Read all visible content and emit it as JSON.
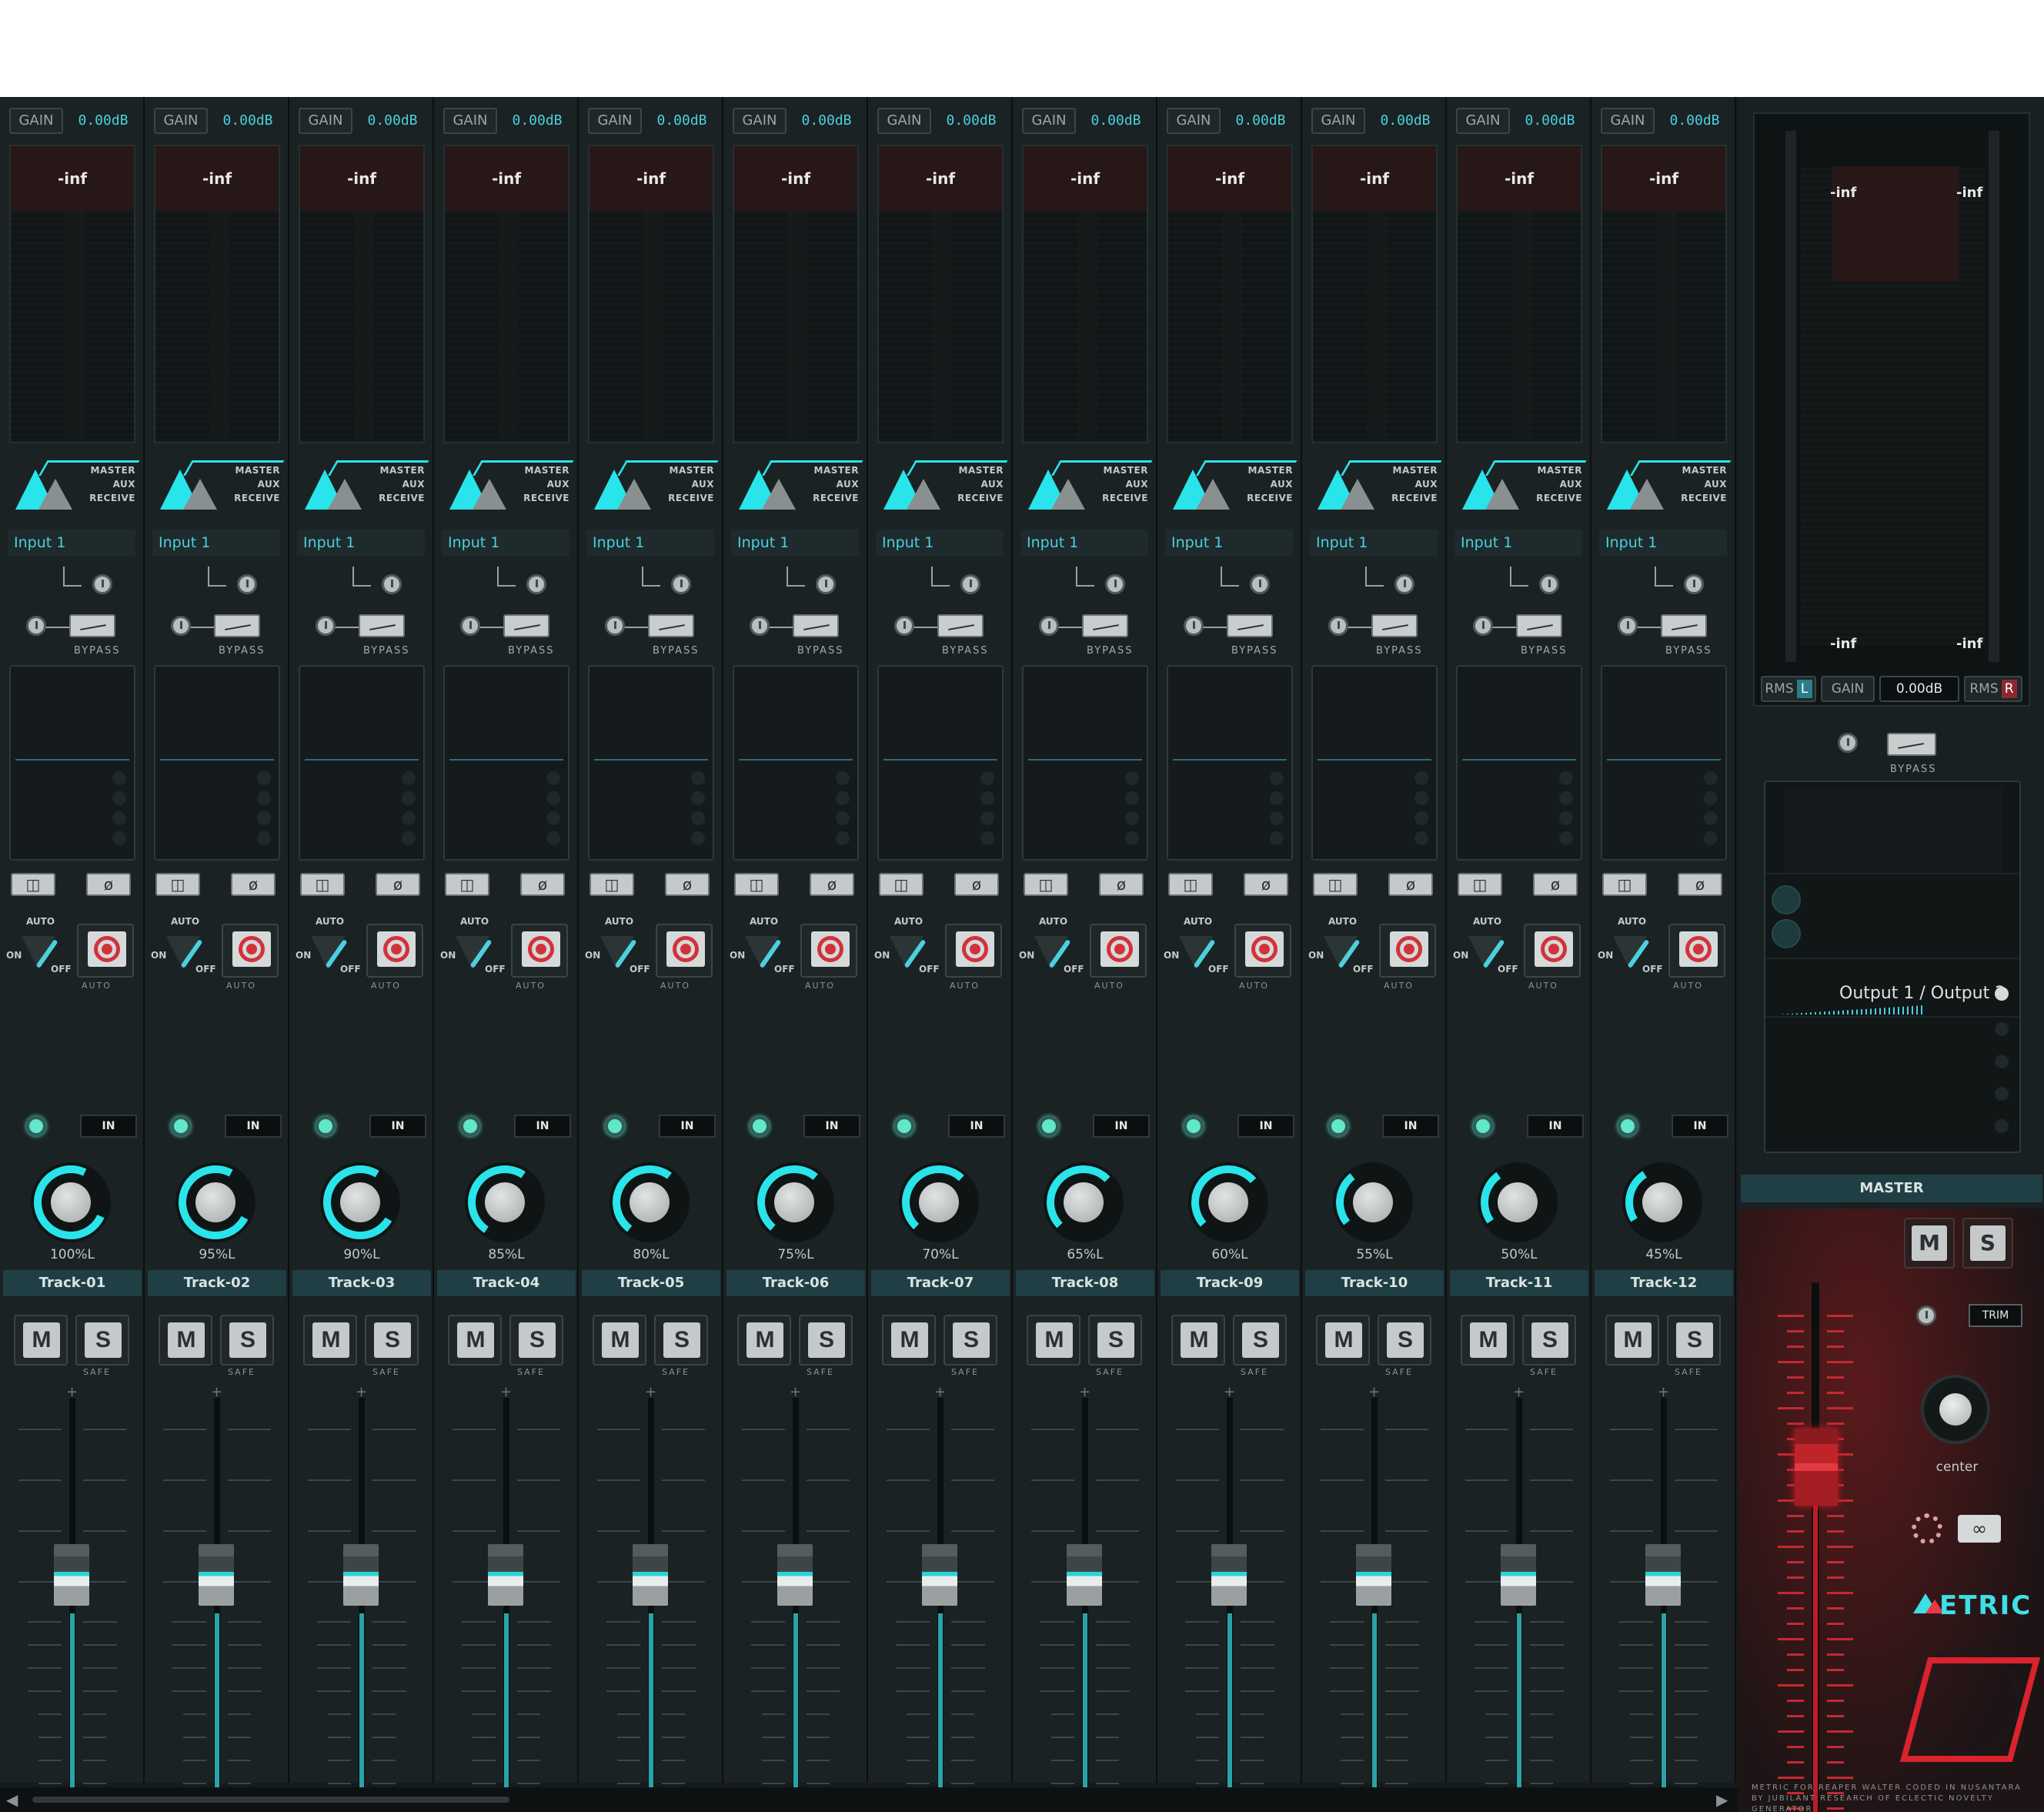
{
  "colors": {
    "accent": "#4bd0de",
    "master_red": "#c11c25",
    "background": "#151b1c"
  },
  "channels": [
    {
      "gain_label": "GAIN",
      "gain_value": "0.00dB",
      "peak": "-inf",
      "routing": [
        "MASTER",
        "AUX",
        "RECEIVE"
      ],
      "input": "Input 1",
      "bypass": "BYPASS",
      "auto": "AUTO",
      "on": "ON",
      "off": "OFF",
      "rec_auto": "AUTO",
      "in": "IN",
      "pan": "100%L",
      "pan_fraction": 1.0,
      "name": "Track-01",
      "mute": "M",
      "solo": "S",
      "safe": "SAFE",
      "number": "1"
    },
    {
      "gain_label": "GAIN",
      "gain_value": "0.00dB",
      "peak": "-inf",
      "routing": [
        "MASTER",
        "AUX",
        "RECEIVE"
      ],
      "input": "Input 1",
      "bypass": "BYPASS",
      "auto": "AUTO",
      "on": "ON",
      "off": "OFF",
      "rec_auto": "AUTO",
      "in": "IN",
      "pan": "95%L",
      "pan_fraction": 0.95,
      "name": "Track-02",
      "mute": "M",
      "solo": "S",
      "safe": "SAFE",
      "number": "2"
    },
    {
      "gain_label": "GAIN",
      "gain_value": "0.00dB",
      "peak": "-inf",
      "routing": [
        "MASTER",
        "AUX",
        "RECEIVE"
      ],
      "input": "Input 1",
      "bypass": "BYPASS",
      "auto": "AUTO",
      "on": "ON",
      "off": "OFF",
      "rec_auto": "AUTO",
      "in": "IN",
      "pan": "90%L",
      "pan_fraction": 0.9,
      "name": "Track-03",
      "mute": "M",
      "solo": "S",
      "safe": "SAFE",
      "number": "3"
    },
    {
      "gain_label": "GAIN",
      "gain_value": "0.00dB",
      "peak": "-inf",
      "routing": [
        "MASTER",
        "AUX",
        "RECEIVE"
      ],
      "input": "Input 1",
      "bypass": "BYPASS",
      "auto": "AUTO",
      "on": "ON",
      "off": "OFF",
      "rec_auto": "AUTO",
      "in": "IN",
      "pan": "85%L",
      "pan_fraction": 0.85,
      "name": "Track-04",
      "mute": "M",
      "solo": "S",
      "safe": "SAFE",
      "number": "4"
    },
    {
      "gain_label": "GAIN",
      "gain_value": "0.00dB",
      "peak": "-inf",
      "routing": [
        "MASTER",
        "AUX",
        "RECEIVE"
      ],
      "input": "Input 1",
      "bypass": "BYPASS",
      "auto": "AUTO",
      "on": "ON",
      "off": "OFF",
      "rec_auto": "AUTO",
      "in": "IN",
      "pan": "80%L",
      "pan_fraction": 0.8,
      "name": "Track-05",
      "mute": "M",
      "solo": "S",
      "safe": "SAFE",
      "number": "5"
    },
    {
      "gain_label": "GAIN",
      "gain_value": "0.00dB",
      "peak": "-inf",
      "routing": [
        "MASTER",
        "AUX",
        "RECEIVE"
      ],
      "input": "Input 1",
      "bypass": "BYPASS",
      "auto": "AUTO",
      "on": "ON",
      "off": "OFF",
      "rec_auto": "AUTO",
      "in": "IN",
      "pan": "75%L",
      "pan_fraction": 0.75,
      "name": "Track-06",
      "mute": "M",
      "solo": "S",
      "safe": "SAFE",
      "number": "6"
    },
    {
      "gain_label": "GAIN",
      "gain_value": "0.00dB",
      "peak": "-inf",
      "routing": [
        "MASTER",
        "AUX",
        "RECEIVE"
      ],
      "input": "Input 1",
      "bypass": "BYPASS",
      "auto": "AUTO",
      "on": "ON",
      "off": "OFF",
      "rec_auto": "AUTO",
      "in": "IN",
      "pan": "70%L",
      "pan_fraction": 0.7,
      "name": "Track-07",
      "mute": "M",
      "solo": "S",
      "safe": "SAFE",
      "number": "7"
    },
    {
      "gain_label": "GAIN",
      "gain_value": "0.00dB",
      "peak": "-inf",
      "routing": [
        "MASTER",
        "AUX",
        "RECEIVE"
      ],
      "input": "Input 1",
      "bypass": "BYPASS",
      "auto": "AUTO",
      "on": "ON",
      "off": "OFF",
      "rec_auto": "AUTO",
      "in": "IN",
      "pan": "65%L",
      "pan_fraction": 0.65,
      "name": "Track-08",
      "mute": "M",
      "solo": "S",
      "safe": "SAFE",
      "number": "8"
    },
    {
      "gain_label": "GAIN",
      "gain_value": "0.00dB",
      "peak": "-inf",
      "routing": [
        "MASTER",
        "AUX",
        "RECEIVE"
      ],
      "input": "Input 1",
      "bypass": "BYPASS",
      "auto": "AUTO",
      "on": "ON",
      "off": "OFF",
      "rec_auto": "AUTO",
      "in": "IN",
      "pan": "60%L",
      "pan_fraction": 0.6,
      "name": "Track-09",
      "mute": "M",
      "solo": "S",
      "safe": "SAFE",
      "number": "9"
    },
    {
      "gain_label": "GAIN",
      "gain_value": "0.00dB",
      "peak": "-inf",
      "routing": [
        "MASTER",
        "AUX",
        "RECEIVE"
      ],
      "input": "Input 1",
      "bypass": "BYPASS",
      "auto": "AUTO",
      "on": "ON",
      "off": "OFF",
      "rec_auto": "AUTO",
      "in": "IN",
      "pan": "55%L",
      "pan_fraction": 0.55,
      "name": "Track-10",
      "mute": "M",
      "solo": "S",
      "safe": "SAFE",
      "number": "10"
    },
    {
      "gain_label": "GAIN",
      "gain_value": "0.00dB",
      "peak": "-inf",
      "routing": [
        "MASTER",
        "AUX",
        "RECEIVE"
      ],
      "input": "Input 1",
      "bypass": "BYPASS",
      "auto": "AUTO",
      "on": "ON",
      "off": "OFF",
      "rec_auto": "AUTO",
      "in": "IN",
      "pan": "50%L",
      "pan_fraction": 0.5,
      "name": "Track-11",
      "mute": "M",
      "solo": "S",
      "safe": "SAFE",
      "number": "11"
    },
    {
      "gain_label": "GAIN",
      "gain_value": "0.00dB",
      "peak": "-inf",
      "routing": [
        "MASTER",
        "AUX",
        "RECEIVE"
      ],
      "input": "Input 1",
      "bypass": "BYPASS",
      "auto": "AUTO",
      "on": "ON",
      "off": "OFF",
      "rec_auto": "AUTO",
      "in": "IN",
      "pan": "45%L",
      "pan_fraction": 0.45,
      "name": "Track-12",
      "mute": "M",
      "solo": "S",
      "safe": "SAFE",
      "number": "12"
    }
  ],
  "master": {
    "peak_top_left": "-inf",
    "peak_top_right": "-inf",
    "peak_bottom_left": "-inf",
    "peak_bottom_right": "-inf",
    "rms_left_label": "RMS",
    "rms_left_channel": "L",
    "rms_right_label": "RMS",
    "rms_right_channel": "R",
    "gain_label": "GAIN",
    "gain_value": "0.00dB",
    "bypass": "BYPASS",
    "output_label": "Output 1 / Output 2",
    "name": "MASTER",
    "mute": "M",
    "solo": "S",
    "trim": "TRIM",
    "pan": "center",
    "logo": "ETRIC",
    "footer": "METRIC FOR REAPER WALTER CODED IN NUSANTARA BY JUBILANT RESEARCH OF ECLECTIC NOVELTY GENERATOR"
  }
}
